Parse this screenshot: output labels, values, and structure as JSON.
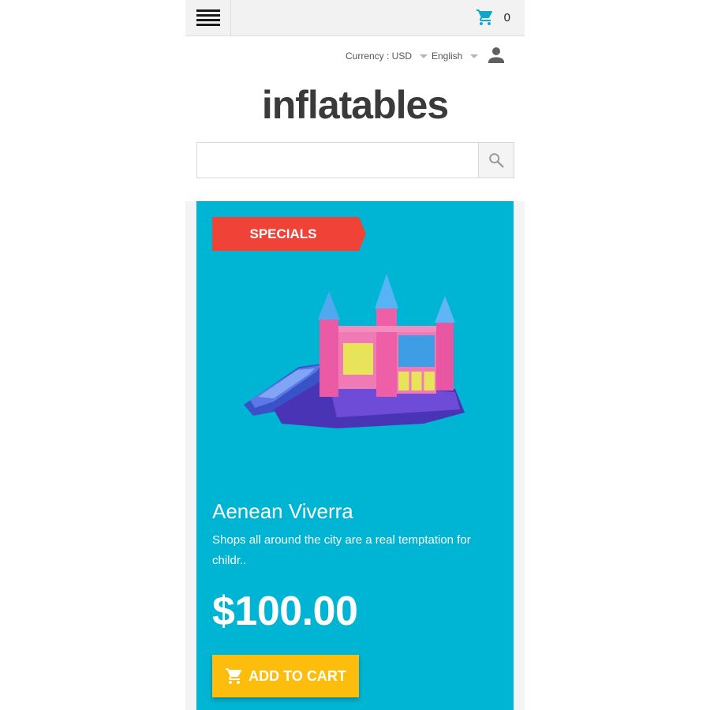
{
  "header": {
    "cart_count": "0",
    "currency_label": "Currency : USD",
    "language_label": "English"
  },
  "logo": {
    "text": "inflatables"
  },
  "search": {
    "value": "",
    "placeholder": ""
  },
  "product": {
    "badge": "SPECIALS",
    "name": "Aenean Viverra",
    "description": "Shops all around the city are a real temptation for childr..",
    "price": "$100.00",
    "add_to_cart_label": "ADD TO CART"
  },
  "colors": {
    "card_bg": "#00b4d3",
    "badge_bg": "#f04337",
    "button_bg": "#fdbd0c",
    "cart_icon": "#12a6c9"
  },
  "icons": {
    "menu": "hamburger-menu-icon",
    "cart": "shopping-cart-icon",
    "user": "user-icon",
    "search": "search-icon"
  }
}
